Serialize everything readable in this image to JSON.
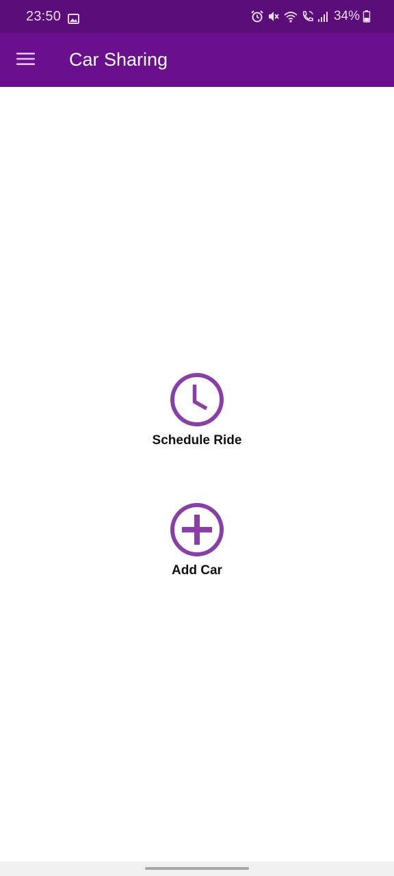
{
  "status_bar": {
    "time": "23:50",
    "battery": "34%",
    "icons": [
      "image-icon",
      "alarm-icon",
      "mute-icon",
      "wifi-icon",
      "wifi-calling-icon",
      "signal-icon",
      "battery-icon"
    ]
  },
  "app_bar": {
    "title": "Car Sharing",
    "menu_icon": "hamburger-menu-icon"
  },
  "actions": {
    "schedule_ride": {
      "label": "Schedule Ride",
      "icon": "clock-icon"
    },
    "add_car": {
      "label": "Add Car",
      "icon": "add-circle-icon"
    }
  },
  "colors": {
    "status_bar_bg": "#5b0d7a",
    "app_bar_bg": "#6a0f8e",
    "accent": "#8a3fa8",
    "label_text": "#111111"
  }
}
